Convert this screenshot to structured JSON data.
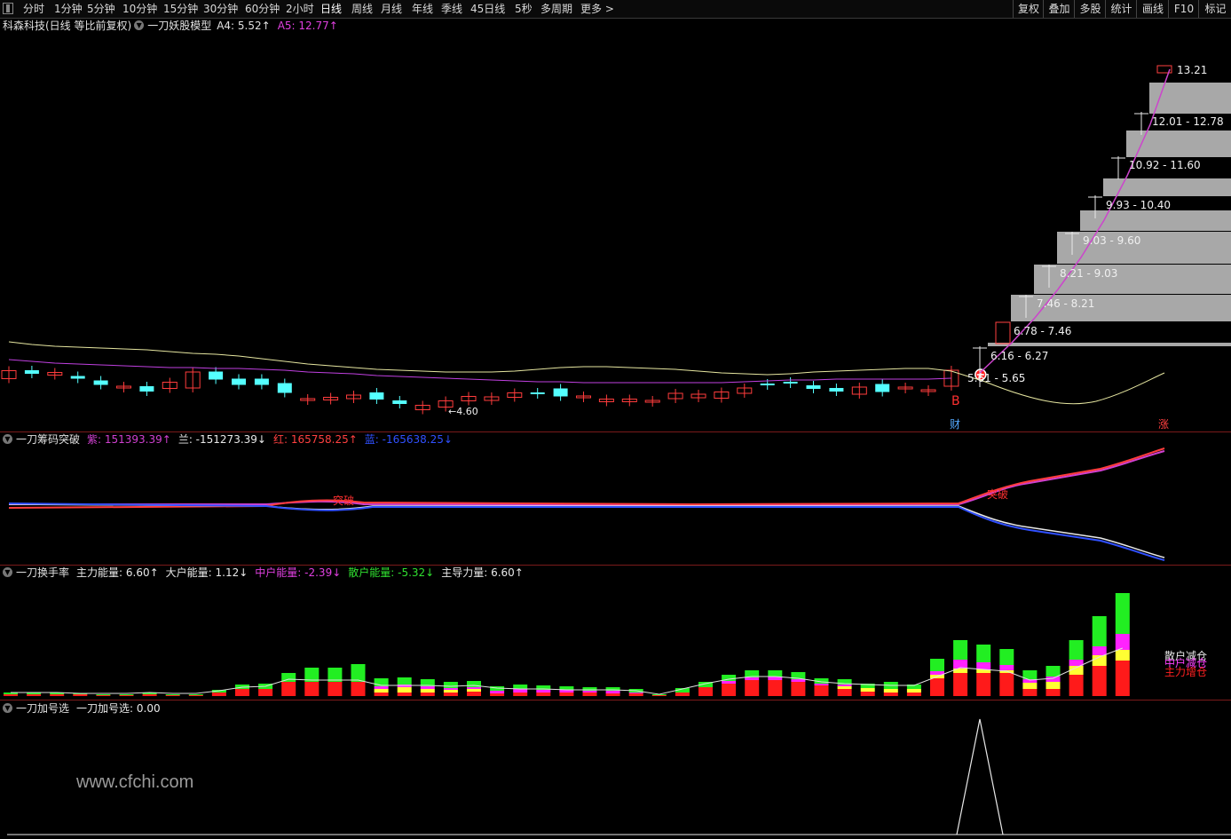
{
  "toolbar": {
    "periods": [
      "分时",
      "1分钟",
      "5分钟",
      "10分钟",
      "15分钟",
      "30分钟",
      "60分钟",
      "2小时",
      "日线",
      "周线",
      "月线",
      "年线",
      "季线",
      "45日线",
      "5秒",
      "多周期",
      "更多 >"
    ],
    "active_period": "日线",
    "right_items": [
      "复权",
      "叠加",
      "多股",
      "统计",
      "画线",
      "F10",
      "标记"
    ]
  },
  "main_panel": {
    "stock": "科森科技(日线 等比前复权)",
    "indicator": "一刀妖股模型",
    "a4_label": "A4: 5.52↑",
    "a5_label": "A5: 12.77↑",
    "low_label": "←4.60",
    "b_label": "B",
    "cai_label": "财",
    "zhang_label": "涨",
    "top_price_label": "13.21",
    "price_ranges": [
      "12.01 - 12.78",
      "10.92 - 11.60",
      "9.93 - 10.40",
      "9.03 - 9.60",
      "8.21 - 9.03",
      "7.46 - 8.21",
      "6.78 - 7.46",
      "6.16 - 6.27",
      "5.61 - 5.65"
    ],
    "colors": {
      "up": "#ff3c3c",
      "down": "#54ffff",
      "ma_yellow": "#e6e6a0",
      "ma_purple": "#c040e0",
      "target_line": "#cc44cc",
      "bars": "#a8a8a8"
    }
  },
  "chip_panel": {
    "title": "一刀筹码突破",
    "zi_label": "紫: 151393.39↑",
    "lan_label": "兰: -151273.39↓",
    "hong_label": "红: 165758.25↑",
    "blue_label": "蓝: -165638.25↓",
    "tupo_label_1": "突破",
    "tupo_label_2": "突破",
    "colors": {
      "zi": "#d040d0",
      "lan": "#e8e8e8",
      "hong": "#ff3c3c",
      "blue": "#3050ff"
    }
  },
  "turnover_panel": {
    "title": "一刀换手率",
    "main_label": "主力能量: 6.60↑",
    "big_label": "大户能量: 1.12↓",
    "mid_label": "中户能量: -2.39↓",
    "retail_label": "散户能量: -5.32↓",
    "lead_label": "主导力量: 6.60↑",
    "legend_1": "散户减仓",
    "legend_2": "中户减仓",
    "legend_3": "主力增仓",
    "colors": {
      "red": "#ff1a1a",
      "yellow": "#ffff33",
      "magenta": "#ff22ff",
      "green": "#22ee22",
      "line": "#e0e0e0"
    }
  },
  "add_panel": {
    "title": "一刀加号选",
    "value_label": "一刀加号选: 0.00"
  },
  "watermark": "www.cfchi.com"
}
